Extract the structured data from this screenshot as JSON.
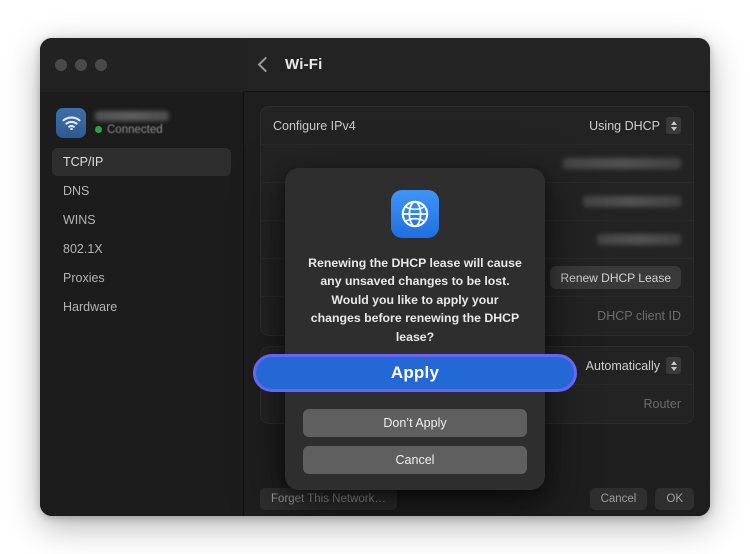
{
  "window": {
    "titlebar": {
      "back_icon": "chevron-left-icon",
      "title": "Wi-Fi",
      "traffic_lights": [
        "close",
        "minimize",
        "zoom"
      ]
    }
  },
  "sidebar": {
    "network": {
      "icon": "wifi-icon",
      "name": "",
      "status": "Connected",
      "status_dot_color": "#2ea043"
    },
    "items": [
      {
        "label": "TCP/IP",
        "selected": true
      },
      {
        "label": "DNS",
        "selected": false
      },
      {
        "label": "WINS",
        "selected": false
      },
      {
        "label": "802.1X",
        "selected": false
      },
      {
        "label": "Proxies",
        "selected": false
      },
      {
        "label": "Hardware",
        "selected": false
      }
    ]
  },
  "content": {
    "ipv4": {
      "configure_label": "Configure IPv4",
      "configure_value": "Using DHCP",
      "rows": [
        {
          "label": "",
          "value": ""
        },
        {
          "label": "",
          "value": ""
        },
        {
          "label": "",
          "value": ""
        }
      ],
      "renew_button": "Renew DHCP Lease",
      "client_id_placeholder": "DHCP client ID"
    },
    "ipv6": {
      "configure_value": "Automatically",
      "router_label": "Router"
    }
  },
  "footer": {
    "forget_label": "Forget This Network…",
    "cancel_label": "Cancel",
    "ok_label": "OK"
  },
  "dialog": {
    "icon": "globe-icon",
    "message": "Renewing the DHCP lease will cause any unsaved changes to be lost. Would you like to apply your changes before renewing the DHCP lease?",
    "apply_label": "Apply",
    "dont_apply_label": "Don’t Apply",
    "cancel_label": "Cancel"
  },
  "colors": {
    "accent_blue": "#2468d6",
    "focus_ring": "#6a64f2",
    "icon_blue": "#2b7ef0",
    "connected_green": "#2ea043",
    "window_bg": "#1d1d1d",
    "dialog_bg": "#2e2e2e"
  }
}
